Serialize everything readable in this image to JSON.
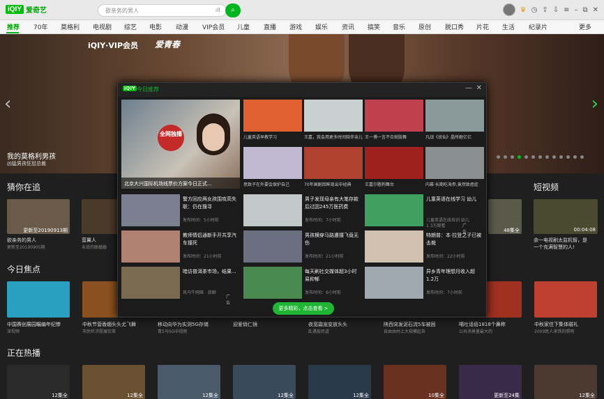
{
  "app": {
    "logo_box": "iQIY",
    "logo_text": "爱奇艺"
  },
  "search": {
    "placeholder": "欲亲务的男人",
    "button_icon": "search-icon"
  },
  "nav": [
    "推荐",
    "70年",
    "莫格利",
    "电视剧",
    "综艺",
    "电影",
    "动漫",
    "VIP会员",
    "儿童",
    "直播",
    "游戏",
    "娱乐",
    "资讯",
    "搞笑",
    "音乐",
    "原创",
    "脱口秀",
    "片花",
    "生活",
    "纪录片",
    "更多"
  ],
  "hero": {
    "brand": "iQIY·VIP会员",
    "brand2": "爱青春",
    "title": "我的莫格利男孩",
    "subtitle": "凶猛男孩狂怼总裁"
  },
  "sections": {
    "guess": "猜你在追",
    "focus": "今日焦点",
    "hot": "正在热播",
    "short": "短视频"
  },
  "guess_cards": [
    {
      "title": "欲亲务的男人",
      "sub": "更新至20190905期",
      "badge": "更新至20190913期",
      "color": "#6a5a4a"
    },
    {
      "title": "蛮翼人",
      "sub": "未说的联婚婚",
      "badge": "",
      "color": "#4a3a2a"
    }
  ],
  "guess_right": {
    "badge": "48集全",
    "color": "#5a5a4a"
  },
  "short_card": {
    "title": "余一电视剧太监机智，是",
    "sub": "一个充满智慧的人!",
    "badge": "00:04:08",
    "color": "#4a4a30"
  },
  "focus_cards": [
    {
      "title": "中国赛创展园瞩编年纪惨",
      "sub": "深视频",
      "color": "#2aa0c0"
    },
    {
      "title": "中秋节营香烟头头尤飞舞",
      "sub": "市民听济愿展饮茶",
      "color": "#8a5020"
    },
    {
      "title": "移动向华为实测5G存储",
      "sub": "青5马5G中视频",
      "color": "#3a3a3a"
    },
    {
      "title": "迎爱俏仁镜",
      "sub": "",
      "color": "#222"
    },
    {
      "title": "夜宽霜宠变放头头",
      "sub": "乱遇疫民道",
      "color": "#5a4030"
    },
    {
      "title": "陕西突发泥石流5车被困",
      "sub": "自由由村上大规模起去",
      "color": "#c05030"
    },
    {
      "title": "噶吐话佰1818个鼻称",
      "sub": "公共消景量最大的",
      "color": "#a03020"
    },
    {
      "title": "中秋家住下集体碰礼",
      "sub": "2009民人来铁的照明",
      "color": "#c04030"
    }
  ],
  "hot_cards": [
    {
      "badge": "12集全",
      "color": "#2a2a2a"
    },
    {
      "badge": "12集全",
      "color": "#6a5030"
    },
    {
      "badge": "12集全",
      "color": "#4a5a6a"
    },
    {
      "badge": "12集全",
      "color": "#3a4a5a"
    },
    {
      "badge": "12集全",
      "color": "#2a3a4a"
    },
    {
      "badge": "10集全",
      "color": "#6a3020"
    },
    {
      "badge": "更新至24集",
      "color": "#3a2a4a"
    },
    {
      "badge": "12集全",
      "color": "#4a3a30"
    }
  ],
  "popup": {
    "logo": "iQIY",
    "title": "今日推荐",
    "big": {
      "caption": "北京大兴国际机场线票价方案今日正式...",
      "stamp": "全网独播"
    },
    "grid": [
      {
        "label": "儿童英语早教学习",
        "color": "#e06030"
      },
      {
        "label": "王嘉，我会用更多时间陪伴亲儿",
        "color": "#c8d0d0"
      },
      {
        "label": "王一博一言不合就肢舞",
        "color": "#c04050"
      },
      {
        "label": "凡战《扶仙》晶所砸亿亿",
        "color": "#8a9a9a"
      },
      {
        "label": "思致子在外要会保护自己",
        "color": "#c0b8d0"
      },
      {
        "label": "70年国剧回眸现出中经典",
        "color": "#b04030"
      },
      {
        "label": "王嘉尔憨狗舞台",
        "color": "#a02020"
      },
      {
        "label": "内幕·长期吃海参,竟然致癌症",
        "color": "#8a9090"
      }
    ],
    "rows": [
      {
        "title": "警方回应两女孩围攻高失联：仍在搜寻",
        "sub": "发布时间：5小时前",
        "color": "#7a8090"
      },
      {
        "title": "男子发现母亲有大笔存款后过因245万医药费",
        "sub": "发布时间：7小时前",
        "color": "#c0c8c8"
      },
      {
        "title": "儿童英语在线学习 幼儿",
        "sub": "儿童英语在线培训 幼儿",
        "color": "#40a060",
        "ad": "广告"
      },
      {
        "title": "教师情侣通新手开共享汽车撞死",
        "sub": "发布时间：21小时前",
        "color": "#b08070"
      },
      {
        "title": "男孩横穿马路遭撞飞竟无伤",
        "sub": "发布时间：21小时前",
        "color": "#6a7080"
      },
      {
        "title": "特朗普：本·拉登之子已被击毙",
        "sub": "发布时间：22小时前",
        "color": "#d0c0b0"
      },
      {
        "title": "暗访普洱茶市场，结果...",
        "sub": "风马牛网络 · 旅聊",
        "color": "#7a6a50",
        "ad": "广告"
      },
      {
        "title": "每天刷社交媒体超3小时易抑郁",
        "sub": "发布时间：6小时前",
        "color": "#4a8a50"
      },
      {
        "title": "异乡青年理想月收入超1.2万",
        "sub": "发布时间：7小时前",
        "color": "#a0a8b0"
      }
    ],
    "more": "更多精彩，点击查看 >",
    "sm_badge": "1.3万观看"
  }
}
